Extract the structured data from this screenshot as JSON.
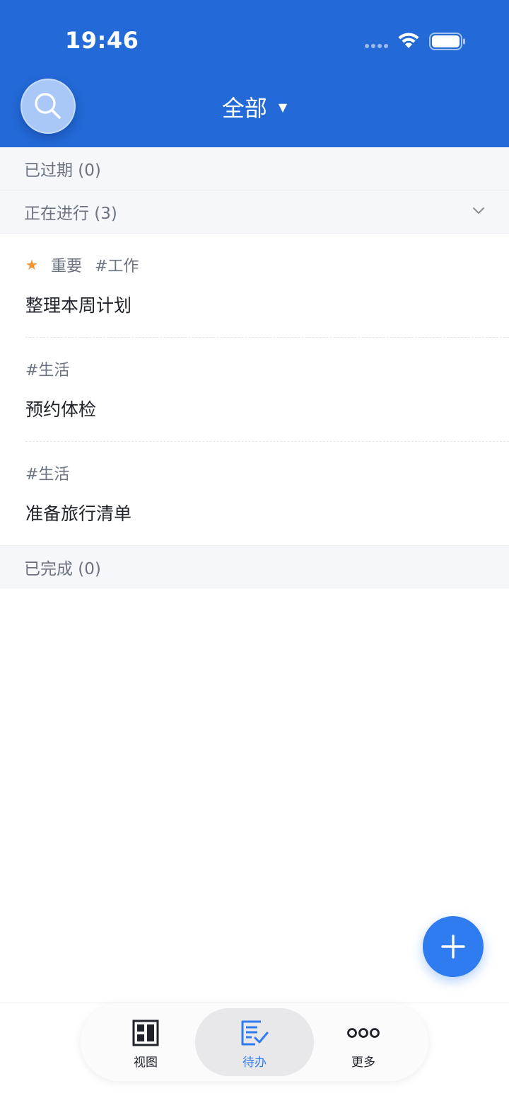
{
  "status_bar": {
    "time": "19:46"
  },
  "header": {
    "title": "全部",
    "caret": "▼"
  },
  "sections": {
    "overdue": "已过期 (0)",
    "in_progress": "正在进行 (3)",
    "completed": "已完成 (0)"
  },
  "tasks": [
    {
      "starred": true,
      "priority": "重要",
      "tag": "#工作",
      "title": "整理本周计划"
    },
    {
      "starred": false,
      "priority": "",
      "tag": "#生活",
      "title": "预约体检"
    },
    {
      "starred": false,
      "priority": "",
      "tag": "#生活",
      "title": "准备旅行清单"
    }
  ],
  "bottom_nav": {
    "items": [
      {
        "label": "视图",
        "icon": "view-layout-icon",
        "active": false
      },
      {
        "label": "待办",
        "icon": "todo-list-icon",
        "active": true
      },
      {
        "label": "更多",
        "icon": "more-dots-icon",
        "active": false
      }
    ]
  },
  "colors": {
    "header_bg": "#2369d7",
    "accent": "#2f7bf0",
    "star": "#f5922f",
    "section_bg": "#f5f7fa"
  }
}
